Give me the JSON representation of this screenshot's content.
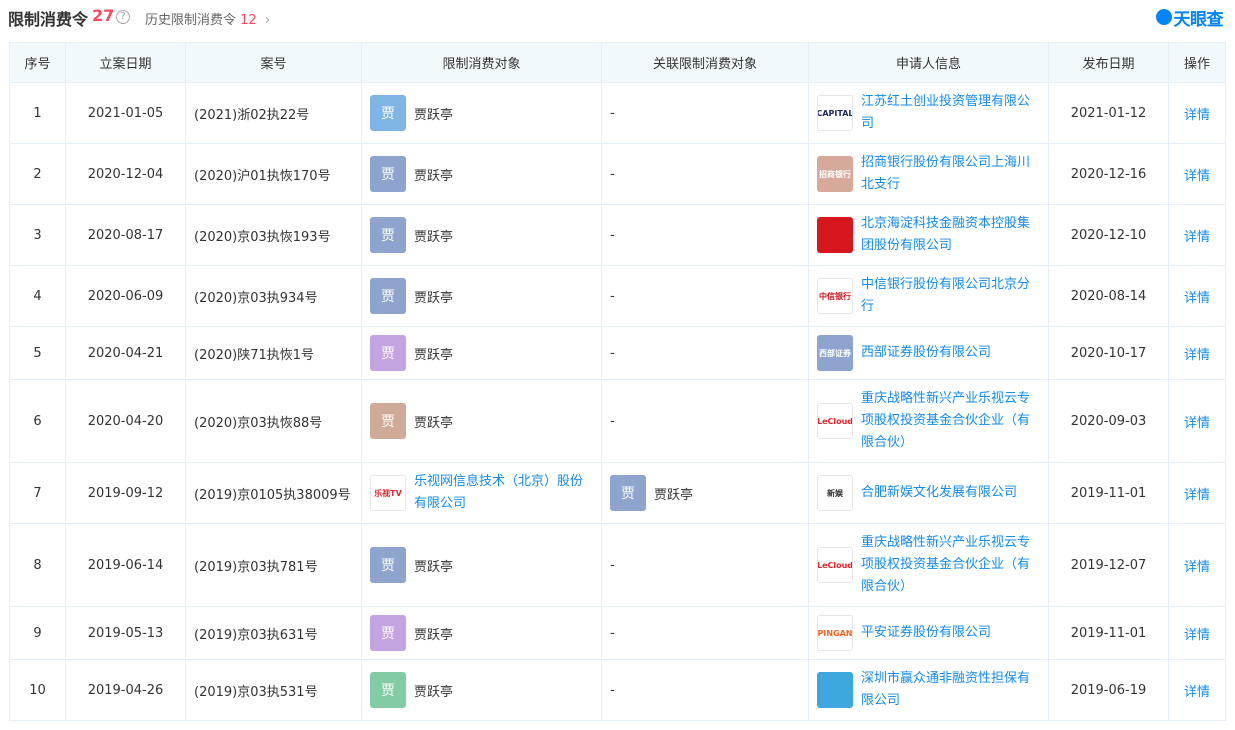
{
  "header": {
    "title": "限制消费令",
    "count": "27",
    "help": "?",
    "history_label": "历史限制消费令",
    "history_count": "12",
    "chevron": "›",
    "brand": "天眼查"
  },
  "columns": [
    "序号",
    "立案日期",
    "案号",
    "限制消费对象",
    "关联限制消费对象",
    "申请人信息",
    "发布日期",
    "操作"
  ],
  "rows": [
    {
      "no": "1",
      "date": "2021-01-05",
      "case": "(2021)浙02执22号",
      "target_type": "person",
      "target_char": "贾",
      "target_color": "#7fb5e4",
      "target_name": "贾跃亭",
      "related": "-",
      "related_type": "none",
      "applicant": "江苏红土创业投资管理有限公司",
      "applicant_logo": "CAPITAL",
      "applicant_logo_bg": "#ffffff",
      "applicant_logo_color": "#1b2a5a",
      "pub": "2021-01-12",
      "action": "详情"
    },
    {
      "no": "2",
      "date": "2020-12-04",
      "case": "(2020)沪01执恢170号",
      "target_type": "person",
      "target_char": "贾",
      "target_color": "#8ea4cf",
      "target_name": "贾跃亭",
      "related": "-",
      "related_type": "none",
      "applicant": "招商银行股份有限公司上海川北支行",
      "applicant_logo": "招商银行",
      "applicant_logo_bg": "#d7a99a",
      "applicant_logo_color": "#ffffff",
      "pub": "2020-12-16",
      "action": "详情"
    },
    {
      "no": "3",
      "date": "2020-08-17",
      "case": "(2020)京03执恢193号",
      "target_type": "person",
      "target_char": "贾",
      "target_color": "#8ea4cf",
      "target_name": "贾跃亭",
      "related": "-",
      "related_type": "none",
      "applicant": "北京海淀科技金融资本控股集团股份有限公司",
      "applicant_logo": "",
      "applicant_logo_bg": "#d6151c",
      "applicant_logo_color": "#ffffff",
      "pub": "2020-12-10",
      "action": "详情"
    },
    {
      "no": "4",
      "date": "2020-06-09",
      "case": "(2020)京03执934号",
      "target_type": "person",
      "target_char": "贾",
      "target_color": "#8ea4cf",
      "target_name": "贾跃亭",
      "related": "-",
      "related_type": "none",
      "applicant": "中信银行股份有限公司北京分行",
      "applicant_logo": "中信银行",
      "applicant_logo_bg": "#ffffff",
      "applicant_logo_color": "#c8161d",
      "pub": "2020-08-14",
      "action": "详情"
    },
    {
      "no": "5",
      "date": "2020-04-21",
      "case": "(2020)陕71执恢1号",
      "target_type": "person",
      "target_char": "贾",
      "target_color": "#c3a3e0",
      "target_name": "贾跃亭",
      "related": "-",
      "related_type": "none",
      "applicant": "西部证券股份有限公司",
      "applicant_logo": "西部证券",
      "applicant_logo_bg": "#8ea4cf",
      "applicant_logo_color": "#ffffff",
      "pub": "2020-10-17",
      "action": "详情"
    },
    {
      "no": "6",
      "date": "2020-04-20",
      "case": "(2020)京03执恢88号",
      "target_type": "person",
      "target_char": "贾",
      "target_color": "#d0aa98",
      "target_name": "贾跃亭",
      "related": "-",
      "related_type": "none",
      "applicant": "重庆战略性新兴产业乐视云专项股权投资基金合伙企业（有限合伙）",
      "applicant_logo": "LeCloud",
      "applicant_logo_bg": "#ffffff",
      "applicant_logo_color": "#e3232c",
      "pub": "2020-09-03",
      "action": "详情"
    },
    {
      "no": "7",
      "date": "2019-09-12",
      "case": "(2019)京0105执38009号",
      "target_type": "company",
      "target_logo": "乐视TV",
      "target_logo_color": "#e3232c",
      "target_name": "乐视网信息技术（北京）股份有限公司",
      "related": "贾跃亭",
      "related_type": "person",
      "related_char": "贾",
      "related_color": "#8ea4cf",
      "applicant": "合肥新娱文化发展有限公司",
      "applicant_logo": "新娱",
      "applicant_logo_bg": "#ffffff",
      "applicant_logo_color": "#333333",
      "pub": "2019-11-01",
      "action": "详情"
    },
    {
      "no": "8",
      "date": "2019-06-14",
      "case": "(2019)京03执781号",
      "target_type": "person",
      "target_char": "贾",
      "target_color": "#8ea4cf",
      "target_name": "贾跃亭",
      "related": "-",
      "related_type": "none",
      "applicant": "重庆战略性新兴产业乐视云专项股权投资基金合伙企业（有限合伙）",
      "applicant_logo": "LeCloud",
      "applicant_logo_bg": "#ffffff",
      "applicant_logo_color": "#e3232c",
      "pub": "2019-12-07",
      "action": "详情"
    },
    {
      "no": "9",
      "date": "2019-05-13",
      "case": "(2019)京03执631号",
      "target_type": "person",
      "target_char": "贾",
      "target_color": "#c3a3e0",
      "target_name": "贾跃亭",
      "related": "-",
      "related_type": "none",
      "applicant": "平安证券股份有限公司",
      "applicant_logo": "PINGAN",
      "applicant_logo_bg": "#ffffff",
      "applicant_logo_color": "#f26522",
      "pub": "2019-11-01",
      "action": "详情"
    },
    {
      "no": "10",
      "date": "2019-04-26",
      "case": "(2019)京03执531号",
      "target_type": "person",
      "target_char": "贾",
      "target_color": "#82cba5",
      "target_name": "贾跃亭",
      "related": "-",
      "related_type": "none",
      "applicant": "深圳市赢众通非融资性担保有限公司",
      "applicant_logo": "",
      "applicant_logo_bg": "#3da7e0",
      "applicant_logo_color": "#ffffff",
      "pub": "2019-06-19",
      "action": "详情"
    }
  ],
  "row_heights": [
    61,
    61,
    61,
    61,
    53,
    83,
    61,
    83,
    53,
    61
  ]
}
